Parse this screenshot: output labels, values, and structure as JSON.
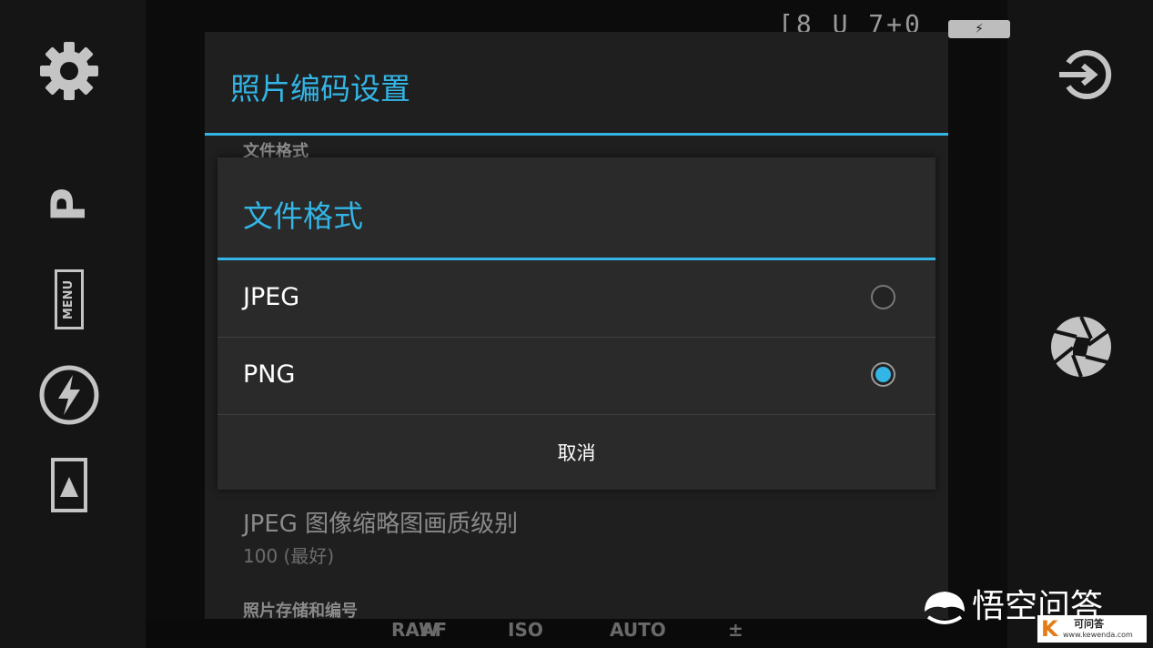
{
  "camera": {
    "status_readout": "[8 U 7+0",
    "mode_label": "P",
    "menu_label": "MENU",
    "bottom_modes": [
      "RAW",
      "AF",
      "ISO",
      "AUTO",
      "±"
    ]
  },
  "settings_panel": {
    "title": "照片编码设置",
    "section_file_format": "文件格式",
    "thumbnail_quality_title": "JPEG 图像缩略图画质级别",
    "thumbnail_quality_value": "100 (最好)",
    "section_storage": "照片存储和编号"
  },
  "dialog": {
    "title": "文件格式",
    "options": [
      {
        "label": "JPEG",
        "selected": false
      },
      {
        "label": "PNG",
        "selected": true
      }
    ],
    "cancel_label": "取消"
  },
  "watermark": {
    "text": "悟空问答",
    "site_name": "可问答",
    "site_url": "www.kewenda.com"
  },
  "colors": {
    "accent": "#33b5e5",
    "dialog_bg": "#2a2a2a",
    "panel_bg": "#1f1f1f"
  }
}
